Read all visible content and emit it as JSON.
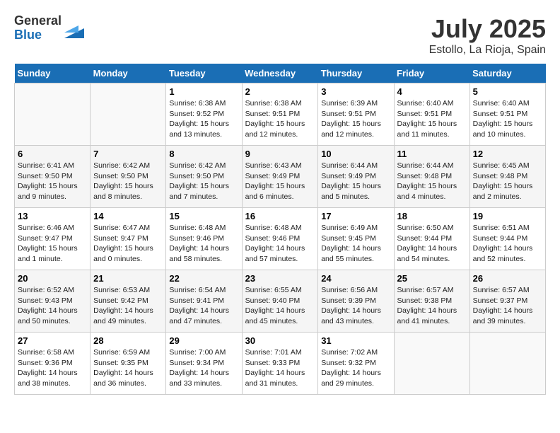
{
  "header": {
    "logo_general": "General",
    "logo_blue": "Blue",
    "month_year": "July 2025",
    "location": "Estollo, La Rioja, Spain"
  },
  "days_of_week": [
    "Sunday",
    "Monday",
    "Tuesday",
    "Wednesday",
    "Thursday",
    "Friday",
    "Saturday"
  ],
  "weeks": [
    [
      {
        "day": "",
        "detail": ""
      },
      {
        "day": "",
        "detail": ""
      },
      {
        "day": "1",
        "detail": "Sunrise: 6:38 AM\nSunset: 9:52 PM\nDaylight: 15 hours\nand 13 minutes."
      },
      {
        "day": "2",
        "detail": "Sunrise: 6:38 AM\nSunset: 9:51 PM\nDaylight: 15 hours\nand 12 minutes."
      },
      {
        "day": "3",
        "detail": "Sunrise: 6:39 AM\nSunset: 9:51 PM\nDaylight: 15 hours\nand 12 minutes."
      },
      {
        "day": "4",
        "detail": "Sunrise: 6:40 AM\nSunset: 9:51 PM\nDaylight: 15 hours\nand 11 minutes."
      },
      {
        "day": "5",
        "detail": "Sunrise: 6:40 AM\nSunset: 9:51 PM\nDaylight: 15 hours\nand 10 minutes."
      }
    ],
    [
      {
        "day": "6",
        "detail": "Sunrise: 6:41 AM\nSunset: 9:50 PM\nDaylight: 15 hours\nand 9 minutes."
      },
      {
        "day": "7",
        "detail": "Sunrise: 6:42 AM\nSunset: 9:50 PM\nDaylight: 15 hours\nand 8 minutes."
      },
      {
        "day": "8",
        "detail": "Sunrise: 6:42 AM\nSunset: 9:50 PM\nDaylight: 15 hours\nand 7 minutes."
      },
      {
        "day": "9",
        "detail": "Sunrise: 6:43 AM\nSunset: 9:49 PM\nDaylight: 15 hours\nand 6 minutes."
      },
      {
        "day": "10",
        "detail": "Sunrise: 6:44 AM\nSunset: 9:49 PM\nDaylight: 15 hours\nand 5 minutes."
      },
      {
        "day": "11",
        "detail": "Sunrise: 6:44 AM\nSunset: 9:48 PM\nDaylight: 15 hours\nand 4 minutes."
      },
      {
        "day": "12",
        "detail": "Sunrise: 6:45 AM\nSunset: 9:48 PM\nDaylight: 15 hours\nand 2 minutes."
      }
    ],
    [
      {
        "day": "13",
        "detail": "Sunrise: 6:46 AM\nSunset: 9:47 PM\nDaylight: 15 hours\nand 1 minute."
      },
      {
        "day": "14",
        "detail": "Sunrise: 6:47 AM\nSunset: 9:47 PM\nDaylight: 15 hours\nand 0 minutes."
      },
      {
        "day": "15",
        "detail": "Sunrise: 6:48 AM\nSunset: 9:46 PM\nDaylight: 14 hours\nand 58 minutes."
      },
      {
        "day": "16",
        "detail": "Sunrise: 6:48 AM\nSunset: 9:46 PM\nDaylight: 14 hours\nand 57 minutes."
      },
      {
        "day": "17",
        "detail": "Sunrise: 6:49 AM\nSunset: 9:45 PM\nDaylight: 14 hours\nand 55 minutes."
      },
      {
        "day": "18",
        "detail": "Sunrise: 6:50 AM\nSunset: 9:44 PM\nDaylight: 14 hours\nand 54 minutes."
      },
      {
        "day": "19",
        "detail": "Sunrise: 6:51 AM\nSunset: 9:44 PM\nDaylight: 14 hours\nand 52 minutes."
      }
    ],
    [
      {
        "day": "20",
        "detail": "Sunrise: 6:52 AM\nSunset: 9:43 PM\nDaylight: 14 hours\nand 50 minutes."
      },
      {
        "day": "21",
        "detail": "Sunrise: 6:53 AM\nSunset: 9:42 PM\nDaylight: 14 hours\nand 49 minutes."
      },
      {
        "day": "22",
        "detail": "Sunrise: 6:54 AM\nSunset: 9:41 PM\nDaylight: 14 hours\nand 47 minutes."
      },
      {
        "day": "23",
        "detail": "Sunrise: 6:55 AM\nSunset: 9:40 PM\nDaylight: 14 hours\nand 45 minutes."
      },
      {
        "day": "24",
        "detail": "Sunrise: 6:56 AM\nSunset: 9:39 PM\nDaylight: 14 hours\nand 43 minutes."
      },
      {
        "day": "25",
        "detail": "Sunrise: 6:57 AM\nSunset: 9:38 PM\nDaylight: 14 hours\nand 41 minutes."
      },
      {
        "day": "26",
        "detail": "Sunrise: 6:57 AM\nSunset: 9:37 PM\nDaylight: 14 hours\nand 39 minutes."
      }
    ],
    [
      {
        "day": "27",
        "detail": "Sunrise: 6:58 AM\nSunset: 9:36 PM\nDaylight: 14 hours\nand 38 minutes."
      },
      {
        "day": "28",
        "detail": "Sunrise: 6:59 AM\nSunset: 9:35 PM\nDaylight: 14 hours\nand 36 minutes."
      },
      {
        "day": "29",
        "detail": "Sunrise: 7:00 AM\nSunset: 9:34 PM\nDaylight: 14 hours\nand 33 minutes."
      },
      {
        "day": "30",
        "detail": "Sunrise: 7:01 AM\nSunset: 9:33 PM\nDaylight: 14 hours\nand 31 minutes."
      },
      {
        "day": "31",
        "detail": "Sunrise: 7:02 AM\nSunset: 9:32 PM\nDaylight: 14 hours\nand 29 minutes."
      },
      {
        "day": "",
        "detail": ""
      },
      {
        "day": "",
        "detail": ""
      }
    ]
  ]
}
